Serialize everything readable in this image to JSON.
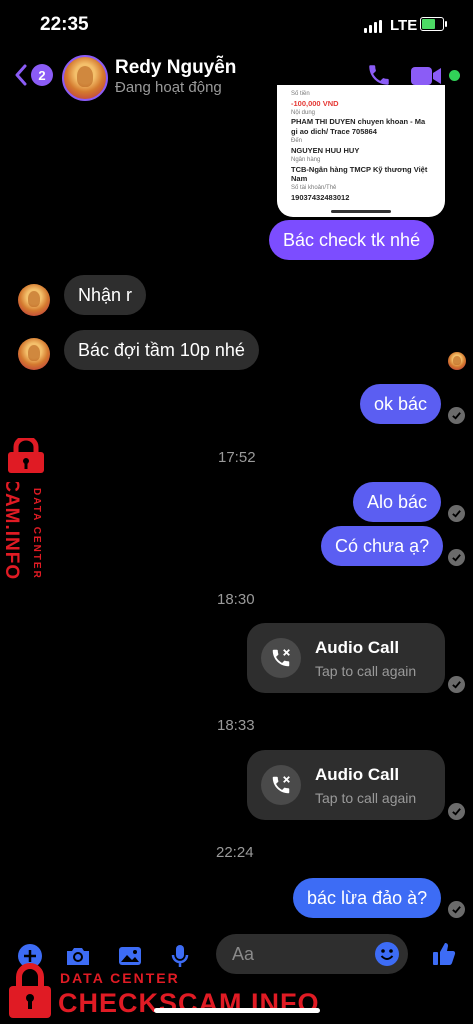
{
  "status_bar": {
    "time": "22:35",
    "network": "LTE"
  },
  "header": {
    "unread_count": "2",
    "name": "Redy Nguyễn",
    "status": "Đang hoạt động"
  },
  "receipt": {
    "amount_label": "Số tiền",
    "amount": "-100,000 VND",
    "content_label": "Nội dung",
    "content": "PHAM THI DUYEN chuyen khoan - Ma gi ao dich/ Trace 705864",
    "to_label": "Đến",
    "to": "NGUYEN HUU HUY",
    "bank_label": "Ngân hàng",
    "bank": "TCB-Ngân hàng TMCP Kỹ thương Việt Nam",
    "account_label": "Số tài khoản/Thẻ",
    "account": "19037432483012"
  },
  "messages": {
    "m1": "Bác check tk nhé",
    "m2": "Nhận r",
    "m3": "Bác đợi tầm 10p nhé",
    "m4": "ok bác",
    "t1": "17:52",
    "m5": "Alo bác",
    "m6": "Có chưa ạ?",
    "t2": "18:30",
    "t3": "18:33",
    "t4": "22:24",
    "m7": "bác lừa đảo à?"
  },
  "calls": [
    {
      "title": "Audio Call",
      "subtitle": "Tap to call again"
    },
    {
      "title": "Audio Call",
      "subtitle": "Tap to call again"
    }
  ],
  "composer": {
    "placeholder": "Aa"
  },
  "watermark": {
    "data_center": "DATA CENTER",
    "site": "CHECKSCAM.INFO"
  },
  "colors": {
    "accent": "#7c4dff",
    "online": "#31d158",
    "watermark": "#e01b24"
  },
  "icons": [
    "back-chevron-icon",
    "phone-icon",
    "video-camera-icon",
    "plus-icon",
    "camera-icon",
    "image-icon",
    "microphone-icon",
    "emoji-icon",
    "thumbs-up-icon",
    "missed-call-icon",
    "checkmark-icon",
    "lock-icon"
  ]
}
